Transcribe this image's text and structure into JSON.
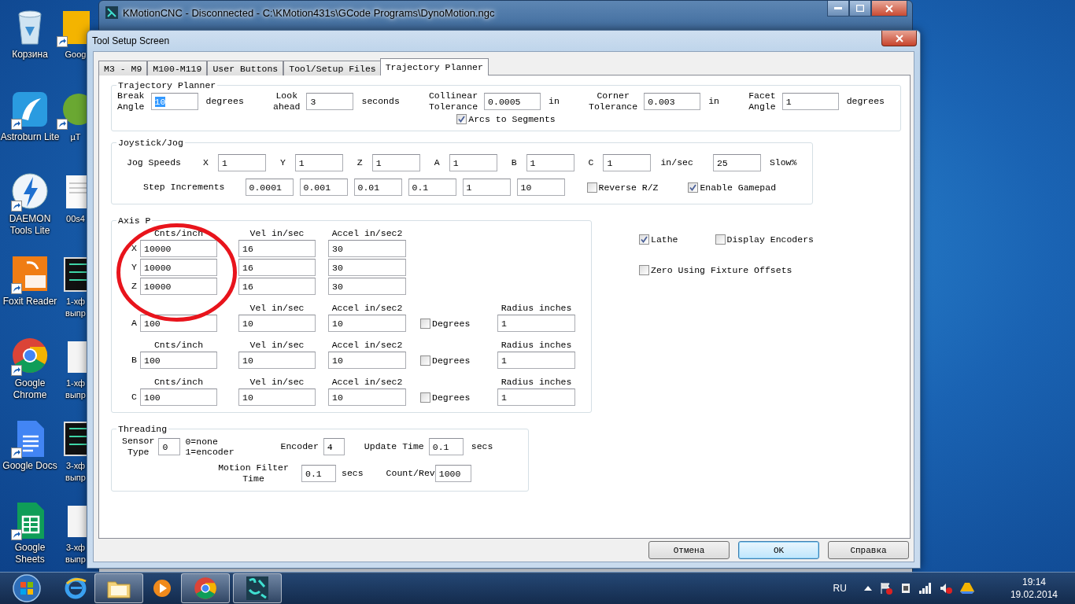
{
  "desktop": {
    "icons": [
      {
        "kind": "trash",
        "label": "Корзина",
        "shortcut": false
      },
      {
        "kind": "astroburn",
        "label": "Astroburn Lite",
        "shortcut": true
      },
      {
        "kind": "daemon",
        "label": "DAEMON Tools Lite",
        "shortcut": true
      },
      {
        "kind": "pdf",
        "label": "Foxit Reader",
        "shortcut": true
      },
      {
        "kind": "chrome",
        "label": "Google Chrome",
        "shortcut": true
      },
      {
        "kind": "docs",
        "label": "Google Docs",
        "shortcut": true
      },
      {
        "kind": "sheets",
        "label": "Google Sheets",
        "shortcut": true
      }
    ],
    "partial_icons": [
      {
        "kind": "slides",
        "label": "Goog",
        "shortcut": true
      },
      {
        "kind": "torrent",
        "label": "µT",
        "shortcut": true
      },
      {
        "kind": "page",
        "label": "00s4",
        "shortcut": false
      },
      {
        "kind": "chip",
        "label": "1-хф выпр",
        "shortcut": false
      },
      {
        "kind": "blank",
        "label": "1-хф выпр",
        "shortcut": false
      },
      {
        "kind": "chip",
        "label": "3-хф выпр",
        "shortcut": false
      },
      {
        "kind": "blank",
        "label": "3-хф выпр",
        "shortcut": false
      }
    ]
  },
  "main_window": {
    "title": "KMotionCNC - Disconnected - C:\\KMotion431s\\GCode Programs\\DynoMotion.ngc"
  },
  "dialog": {
    "title": "Tool Setup Screen",
    "tabs": [
      {
        "label": "M3 - M9",
        "selected": false
      },
      {
        "label": "M100-M119",
        "selected": false
      },
      {
        "label": "User Buttons",
        "selected": false
      },
      {
        "label": "Tool/Setup Files",
        "selected": false
      },
      {
        "label": "Trajectory Planner",
        "selected": true
      }
    ],
    "trajectory": {
      "legend": "Trajectory Planner",
      "fields": [
        {
          "label": "Break Angle",
          "value": "10",
          "unit": "degrees",
          "text_selected": true
        },
        {
          "label": "Look ahead",
          "value": "3",
          "unit": "seconds",
          "text_selected": false
        },
        {
          "label": "Collinear Tolerance",
          "value": "0.0005",
          "unit": "in",
          "text_selected": false
        },
        {
          "label": "Corner Tolerance",
          "value": "0.003",
          "unit": "in",
          "text_selected": false
        },
        {
          "label": "Facet Angle",
          "value": "1",
          "unit": "degrees",
          "text_selected": false
        }
      ],
      "arcs": {
        "label": "Arcs to Segments",
        "checked": true
      }
    },
    "joystick": {
      "legend": "Joystick/Jog",
      "jog_label": "Jog Speeds",
      "jog": [
        {
          "axis": "X",
          "value": "1"
        },
        {
          "axis": "Y",
          "value": "1"
        },
        {
          "axis": "Z",
          "value": "1"
        },
        {
          "axis": "A",
          "value": "1"
        },
        {
          "axis": "B",
          "value": "1"
        },
        {
          "axis": "C",
          "value": "1"
        }
      ],
      "jog_unit": "in/sec",
      "slow_value": "25",
      "slow_label": "Slow%",
      "step_label": "Step Increments",
      "steps": [
        "0.0001",
        "0.001",
        "0.01",
        "0.1",
        "1",
        "10"
      ],
      "reverse": {
        "label": "Reverse R/Z",
        "checked": false
      },
      "gamepad": {
        "label": "Enable Gamepad",
        "checked": true
      }
    },
    "axis": {
      "legend": "Axis P",
      "groups": [
        {
          "headers": {
            "cnts": "Cnts/inch",
            "vel": "Vel in/sec",
            "accel": "Accel in/sec2"
          },
          "rows": [
            {
              "axis": "X",
              "cnts": "10000",
              "vel": "16",
              "accel": "30"
            },
            {
              "axis": "Y",
              "cnts": "10000",
              "vel": "16",
              "accel": "30"
            },
            {
              "axis": "Z",
              "cnts": "10000",
              "vel": "16",
              "accel": "30"
            }
          ]
        },
        {
          "headers": {
            "vel": "Vel in/sec",
            "accel": "Accel in/sec2",
            "radius": "Radius inches"
          },
          "rows": [
            {
              "axis": "A",
              "cnts": "100",
              "vel": "10",
              "accel": "10",
              "degrees": {
                "label": "Degrees",
                "checked": false
              },
              "radius": "1"
            }
          ]
        },
        {
          "headers": {
            "cnts": "Cnts/inch",
            "vel": "Vel in/sec",
            "accel": "Accel in/sec2",
            "radius": "Radius inches"
          },
          "rows": [
            {
              "axis": "B",
              "cnts": "100",
              "vel": "10",
              "accel": "10",
              "degrees": {
                "label": "Degrees",
                "checked": false
              },
              "radius": "1"
            }
          ]
        },
        {
          "headers": {
            "cnts": "Cnts/inch",
            "vel": "Vel in/sec",
            "accel": "Accel in/sec2",
            "radius": "Radius inches"
          },
          "rows": [
            {
              "axis": "C",
              "cnts": "100",
              "vel": "10",
              "accel": "10",
              "degrees": {
                "label": "Degrees",
                "checked": false
              },
              "radius": "1"
            }
          ]
        }
      ]
    },
    "options": [
      {
        "label": "Lathe",
        "checked": true
      },
      {
        "label": "Display Encoders",
        "checked": false
      },
      {
        "label": "Zero Using Fixture Offsets",
        "checked": false
      }
    ],
    "threading": {
      "legend": "Threading",
      "sensor_label": "Sensor Type",
      "sensor_value": "0",
      "sensor_codes": [
        "0=none",
        "1=encoder"
      ],
      "encoder_label": "Encoder",
      "encoder_value": "4",
      "update_label": "Update Time",
      "update_value": "0.1",
      "update_unit": "secs",
      "filter_label": "Motion Filter Time",
      "filter_value": "0.1",
      "filter_unit": "secs",
      "count_label": "Count/Rev",
      "count_value": "1000"
    },
    "buttons": [
      {
        "label": "Отмена",
        "default": false
      },
      {
        "label": "OK",
        "default": true
      },
      {
        "label": "Справка",
        "default": false
      }
    ]
  },
  "taskbar": {
    "apps": [
      {
        "kind": "browser",
        "running": false
      },
      {
        "kind": "folder",
        "running": true
      },
      {
        "kind": "media",
        "running": false
      },
      {
        "kind": "chrome",
        "running": true
      },
      {
        "kind": "cnc",
        "running": true
      }
    ],
    "language": "RU",
    "time": "19:14",
    "date": "19.02.2014"
  }
}
